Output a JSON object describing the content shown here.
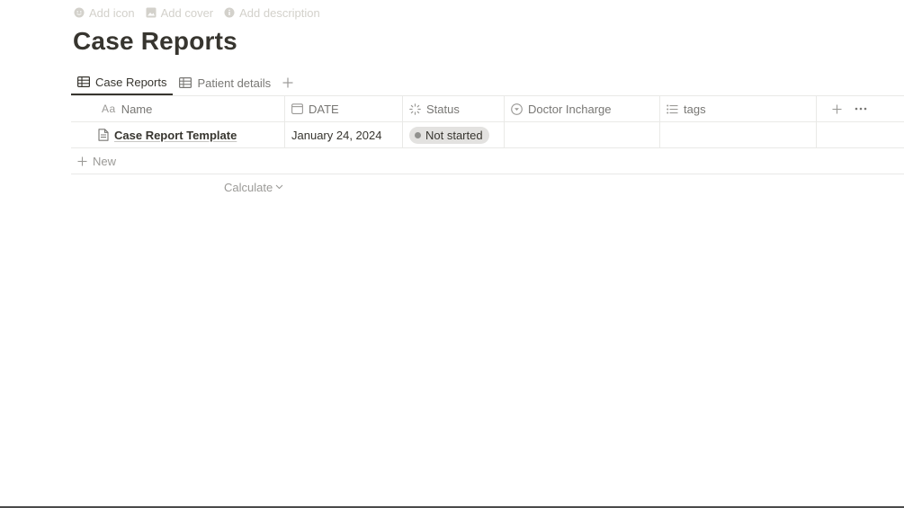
{
  "page_actions": {
    "add_icon": "Add icon",
    "add_cover": "Add cover",
    "add_description": "Add description"
  },
  "title": "Case Reports",
  "view_tabs": [
    {
      "label": "Case Reports",
      "icon": "table-icon",
      "active": true
    },
    {
      "label": "Patient details",
      "icon": "table-icon",
      "active": false
    }
  ],
  "add_view_symbol": "+",
  "columns": [
    {
      "label": "Name",
      "icon": "text-property-icon",
      "icon_text": "Aa"
    },
    {
      "label": "DATE",
      "icon": "calendar-icon"
    },
    {
      "label": "Status",
      "icon": "status-icon"
    },
    {
      "label": "Doctor Incharge",
      "icon": "select-icon"
    },
    {
      "label": "tags",
      "icon": "list-icon"
    }
  ],
  "header_actions": {
    "add": "+",
    "more": "···"
  },
  "rows": [
    {
      "name": "Case Report Template",
      "date": "January 24, 2024",
      "status": "Not started",
      "doctor": "",
      "tags": ""
    }
  ],
  "new_label": "New",
  "calculate_label": "Calculate",
  "colors": {
    "text": "#37352f",
    "muted": "#787774",
    "faint": "#d3d1cb",
    "status_pill_bg": "#e3e2e0",
    "status_dot": "#91918e"
  }
}
